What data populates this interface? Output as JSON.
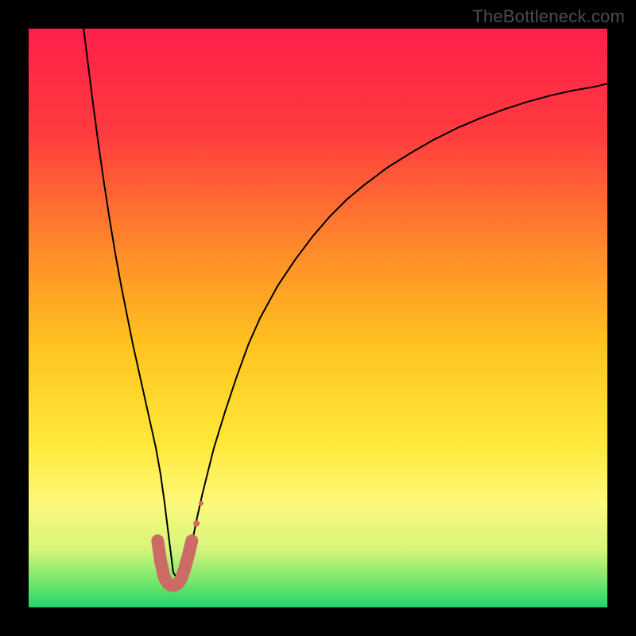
{
  "watermark": "TheBottleneck.com",
  "chart_data": {
    "type": "line",
    "title": "",
    "xlabel": "",
    "ylabel": "",
    "xlim": [
      0,
      100
    ],
    "ylim": [
      0,
      100
    ],
    "grid": false,
    "legend": false,
    "gradient_stops": [
      {
        "offset": 0,
        "color": "#ff1f4a"
      },
      {
        "offset": 18,
        "color": "#ff3b3f"
      },
      {
        "offset": 38,
        "color": "#ff8a2a"
      },
      {
        "offset": 55,
        "color": "#ffc41f"
      },
      {
        "offset": 72,
        "color": "#ffe93a"
      },
      {
        "offset": 82,
        "color": "#fdf97b"
      },
      {
        "offset": 90,
        "color": "#d6f57a"
      },
      {
        "offset": 95,
        "color": "#7fe86d"
      },
      {
        "offset": 100,
        "color": "#20d66a"
      }
    ],
    "series": [
      {
        "name": "curve",
        "stroke": "#000000",
        "stroke_width": 2,
        "x": [
          9.5,
          10,
          11,
          12,
          13,
          14,
          15,
          16,
          17,
          18,
          19,
          20,
          21,
          22,
          22.8,
          23.5,
          24.3,
          25,
          25.7,
          26.3,
          27,
          28,
          29,
          30,
          31,
          32,
          34,
          36,
          38,
          40,
          43,
          46,
          49,
          52,
          55,
          58,
          62,
          66,
          70,
          74,
          78,
          82,
          86,
          90,
          94,
          98,
          100
        ],
        "y": [
          100,
          96,
          88,
          80.5,
          73.5,
          67,
          61,
          55.5,
          50.5,
          45.5,
          41,
          36.5,
          32,
          27.5,
          23,
          18,
          11.5,
          6,
          5,
          5.5,
          6,
          10,
          15,
          19.5,
          23.5,
          27.5,
          34,
          40,
          45.5,
          50,
          55.5,
          60,
          64,
          67.5,
          70.5,
          73,
          76,
          78.5,
          80.8,
          82.8,
          84.5,
          86,
          87.3,
          88.4,
          89.3,
          90,
          90.5
        ]
      },
      {
        "name": "highlight",
        "stroke": "#cc6a66",
        "stroke_width": 16,
        "linecap": "round",
        "x": [
          22.3,
          22.8,
          23.4,
          24.0,
          24.6,
          25.2,
          25.8,
          26.4,
          27.0,
          27.6,
          28.2
        ],
        "y": [
          11.5,
          8.0,
          5.3,
          4.2,
          3.8,
          3.8,
          4.1,
          5.0,
          6.8,
          9.0,
          11.5
        ]
      }
    ],
    "highlight_dots": {
      "stroke": "#cc6a66",
      "radius": 6,
      "x": [
        27.6,
        28.2,
        29.0,
        29.8
      ],
      "y": [
        9.0,
        11.5,
        14.5,
        18.0
      ]
    }
  }
}
